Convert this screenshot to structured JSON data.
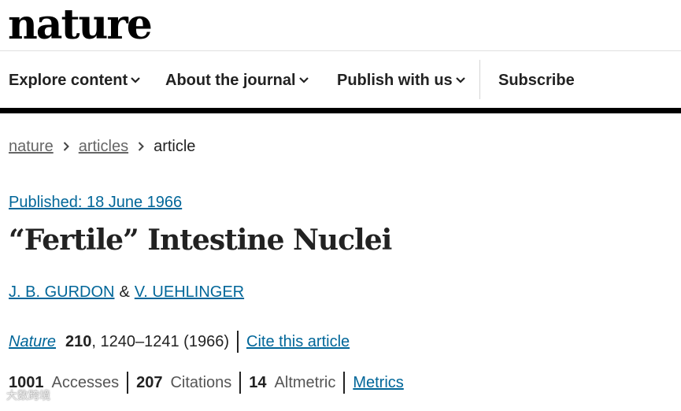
{
  "site": {
    "logo": "nature"
  },
  "nav": {
    "items": [
      {
        "label": "Explore content"
      },
      {
        "label": "About the journal"
      },
      {
        "label": "Publish with us"
      }
    ],
    "subscribe": "Subscribe"
  },
  "breadcrumb": {
    "home": "nature",
    "section": "articles",
    "current": "article"
  },
  "article": {
    "published": "Published: 18 June 1966",
    "title": "“Fertile” Intestine Nuclei",
    "authors": [
      "J. B. GURDON",
      "V. UEHLINGER"
    ],
    "author_separator": "&",
    "journal": "Nature",
    "volume": "210",
    "pages_year": ", 1240–1241 (1966)",
    "cite_label": "Cite this article"
  },
  "metrics": {
    "accesses": {
      "value": "1001",
      "label": "Accesses"
    },
    "citations": {
      "value": "207",
      "label": "Citations"
    },
    "altmetric": {
      "value": "14",
      "label": "Altmetric"
    },
    "link": "Metrics"
  },
  "watermark": "大数跨境"
}
